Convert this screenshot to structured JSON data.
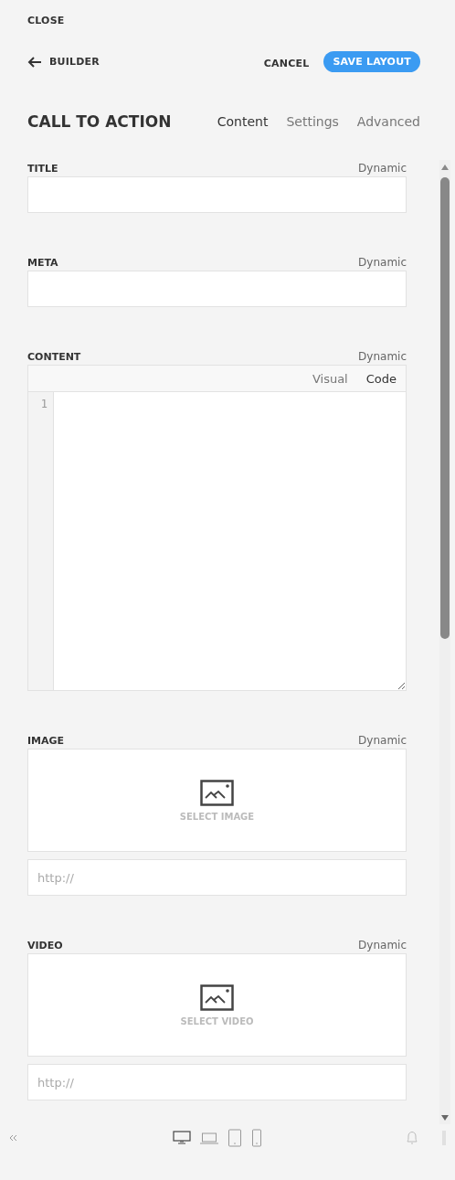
{
  "close": "CLOSE",
  "back": "BUILDER",
  "actions": {
    "cancel": "CANCEL",
    "save": "SAVE LAYOUT"
  },
  "title": "CALL TO ACTION",
  "tabs": [
    {
      "label": "Content",
      "selected": true
    },
    {
      "label": "Settings",
      "selected": false
    },
    {
      "label": "Advanced",
      "selected": false
    }
  ],
  "fields": [
    {
      "kind": "text",
      "label": "TITLE",
      "dynamic": "Dynamic"
    },
    {
      "kind": "text",
      "label": "META",
      "dynamic": "Dynamic"
    },
    {
      "kind": "code",
      "label": "CONTENT",
      "dynamic": "Dynamic",
      "modes": [
        {
          "label": "Visual",
          "selected": false
        },
        {
          "label": "Code",
          "selected": true
        }
      ],
      "line_numbers": [
        "1"
      ]
    },
    {
      "kind": "media",
      "label": "IMAGE",
      "dynamic": "Dynamic",
      "select": "SELECT IMAGE",
      "placeholder": "http://"
    },
    {
      "kind": "media",
      "label": "VIDEO",
      "dynamic": "Dynamic",
      "select": "SELECT VIDEO",
      "placeholder": "http://"
    }
  ],
  "devices": [
    {
      "kind": "desktop",
      "selected": true
    },
    {
      "kind": "laptop",
      "selected": false
    },
    {
      "kind": "tablet",
      "selected": false
    },
    {
      "kind": "phone",
      "selected": false
    }
  ]
}
